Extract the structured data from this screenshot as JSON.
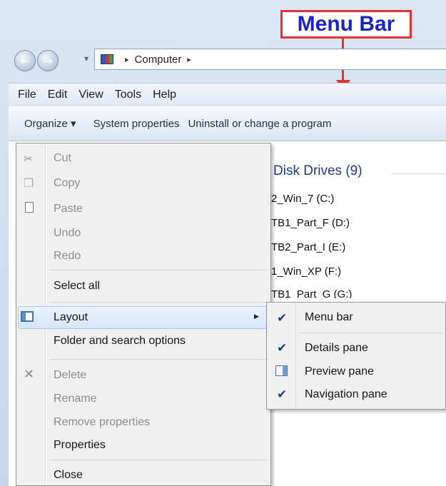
{
  "annotation": {
    "callout": "Menu Bar"
  },
  "address": {
    "segments": [
      "Computer"
    ],
    "separator": "▸"
  },
  "menubar": {
    "items": [
      "File",
      "Edit",
      "View",
      "Tools",
      "Help"
    ]
  },
  "cmdbar": {
    "organize": "Organize ▾",
    "system_properties": "System properties",
    "uninstall": "Uninstall or change a program"
  },
  "content": {
    "group_header": "Disk Drives (9)",
    "drives": [
      "2_Win_7 (C:)",
      "TB1_Part_F (D:)",
      "TB2_Part_I (E:)",
      "1_Win_XP (F:)",
      "TB1_Part_G (G:)"
    ]
  },
  "organize_menu": {
    "cut": "Cut",
    "copy": "Copy",
    "paste": "Paste",
    "undo": "Undo",
    "redo": "Redo",
    "select_all": "Select all",
    "layout": "Layout",
    "folder_options": "Folder and search options",
    "delete": "Delete",
    "rename": "Rename",
    "remove_properties": "Remove properties",
    "properties": "Properties",
    "close": "Close"
  },
  "layout_submenu": {
    "menu_bar": "Menu bar",
    "details_pane": "Details pane",
    "preview_pane": "Preview pane",
    "navigation_pane": "Navigation pane"
  },
  "colors": {
    "callout_border": "#e23232",
    "callout_text": "#1a23c7",
    "highlight": "#d5e6f9"
  },
  "icons": {
    "back": "back-arrow-icon",
    "forward": "forward-arrow-icon",
    "computer": "computer-icon",
    "cut": "scissors-icon",
    "copy": "copy-icon",
    "paste": "paste-icon",
    "layout": "layout-icon",
    "delete": "delete-x-icon",
    "check": "checkmark-icon",
    "preview": "preview-pane-icon"
  }
}
